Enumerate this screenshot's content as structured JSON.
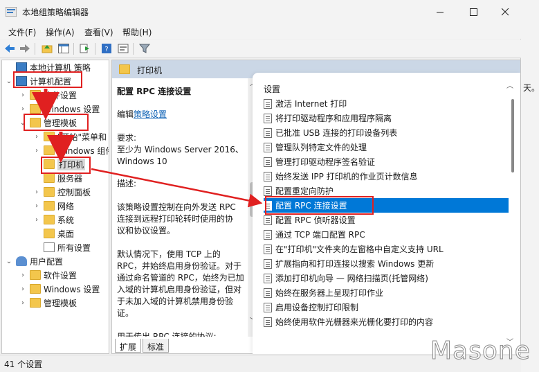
{
  "window": {
    "title": "本地组策略编辑器"
  },
  "background_edge_text": "天。",
  "menubar": {
    "items": [
      "文件(F)",
      "操作(A)",
      "查看(V)",
      "帮助(H)"
    ]
  },
  "tree": {
    "items": [
      {
        "label": "本地计算机 策略",
        "icon": "policy-computer-icon",
        "expander": ""
      },
      {
        "label": "计算机配置",
        "icon": "computer-icon",
        "expander": "v"
      },
      {
        "label": "软件设置",
        "icon": "folder-icon",
        "expander": ">"
      },
      {
        "label": "Windows 设置",
        "icon": "folder-icon",
        "expander": ">"
      },
      {
        "label": "管理模板",
        "icon": "folder-icon",
        "expander": "v"
      },
      {
        "label": "\"开始\"菜单和",
        "icon": "folder-icon",
        "expander": ">"
      },
      {
        "label": "Windows 组件",
        "icon": "folder-icon",
        "expander": ">"
      },
      {
        "label": "打印机",
        "icon": "folder-icon",
        "expander": ""
      },
      {
        "label": "服务器",
        "icon": "folder-icon",
        "expander": ""
      },
      {
        "label": "控制面板",
        "icon": "folder-icon",
        "expander": ">"
      },
      {
        "label": "网络",
        "icon": "folder-icon",
        "expander": ">"
      },
      {
        "label": "系统",
        "icon": "folder-icon",
        "expander": ">"
      },
      {
        "label": "桌面",
        "icon": "folder-icon",
        "expander": ""
      },
      {
        "label": "所有设置",
        "icon": "all-settings-icon",
        "expander": ""
      },
      {
        "label": "用户配置",
        "icon": "user-icon",
        "expander": "v"
      },
      {
        "label": "软件设置",
        "icon": "folder-icon",
        "expander": ">"
      },
      {
        "label": "Windows 设置",
        "icon": "folder-icon",
        "expander": ">"
      },
      {
        "label": "管理模板",
        "icon": "folder-icon",
        "expander": ">"
      }
    ]
  },
  "right_header": {
    "title": "打印机"
  },
  "description": {
    "title": "配置 RPC 连接设置",
    "edit_prefix": "编辑",
    "edit_link": "策略设置",
    "requirements_label": "要求:",
    "requirements_line1": "至少为 Windows Server 2016、",
    "requirements_line2": "Windows 10",
    "desc_label": "描述:",
    "desc_lines": [
      "该策略设置控制在向外发送 RPC",
      "连接到远程打印轮转时使用的协",
      "议和协议设置。",
      "",
      "默认情况下，使用 TCP 上的",
      "RPC，并始终启用身份验证。对于",
      "通过命名管道的 RPC，始终为已加",
      "入域的计算机启用身份验证，但对",
      "于未加入域的计算机禁用身份验",
      "证。",
      "",
      "用于传出 RPC 连接的协议:"
    ]
  },
  "tabs": [
    "扩展",
    "标准"
  ],
  "settings_list": {
    "header": "设置",
    "items": [
      "激活 Internet 打印",
      "将打印驱动程序和应用程序隔离",
      "已批准 USB 连接的打印设备列表",
      "管理队列特定文件的处理",
      "管理打印驱动程序签名验证",
      "始终发送 IPP 打印机的作业页计数信息",
      "配置重定向防护",
      "配置 RPC 连接设置",
      "配置 RPC 侦听器设置",
      "通过 TCP 端口配置 RPC",
      "在\"打印机\"文件夹的左窗格中自定义支持 URL",
      "扩展指向和打印连接以搜索 Windows 更新",
      "添加打印机向导 — 网络扫描页(托管网络)",
      "始终在服务器上呈现打印作业",
      "启用设备控制打印限制",
      "始终使用软件光栅器来光栅化要打印的内容"
    ],
    "selected_index": 7
  },
  "statusbar": {
    "text": "41 个设置"
  },
  "watermark": "Masone",
  "colors": {
    "selection": "#0078d7",
    "annotation": "#e02020",
    "header_band": "#cbd7e6",
    "folder": "#f3c64c"
  }
}
